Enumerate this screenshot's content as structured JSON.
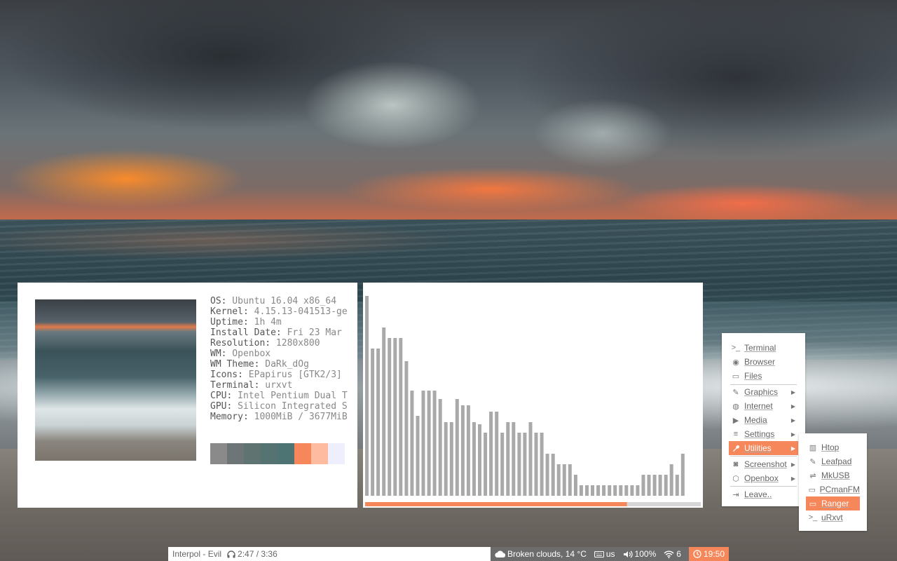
{
  "sysinfo": {
    "lines": [
      {
        "key": "OS:",
        "value": " Ubuntu 16.04 x86_64"
      },
      {
        "key": "Kernel:",
        "value": " 4.15.13-041513-ge"
      },
      {
        "key": "Uptime:",
        "value": " 1h 4m"
      },
      {
        "key": "Install Date:",
        "value": " Fri 23 Mar"
      },
      {
        "key": "Resolution:",
        "value": " 1280x800"
      },
      {
        "key": "WM:",
        "value": " Openbox"
      },
      {
        "key": "WM Theme:",
        "value": " DaRk_dOg"
      },
      {
        "key": "Icons:",
        "value": " EPapirus [GTK2/3]"
      },
      {
        "key": "Terminal:",
        "value": " urxvt"
      },
      {
        "key": "CPU:",
        "value": " Intel Pentium Dual T"
      },
      {
        "key": "GPU:",
        "value": " Silicon Integrated S"
      },
      {
        "key": "Memory:",
        "value": " 1000MiB / 3677MiB"
      }
    ],
    "palette": [
      "#8a8a8a",
      "#6d7576",
      "#5f7370",
      "#557370",
      "#4d7473",
      "#f5875a",
      "#ffbba0",
      "#eeeefc"
    ]
  },
  "visualizer": {
    "levels": [
      0.95,
      0.7,
      0.7,
      0.8,
      0.75,
      0.75,
      0.75,
      0.64,
      0.5,
      0.38,
      0.5,
      0.5,
      0.5,
      0.46,
      0.35,
      0.35,
      0.46,
      0.43,
      0.43,
      0.35,
      0.34,
      0.3,
      0.4,
      0.4,
      0.3,
      0.35,
      0.35,
      0.3,
      0.3,
      0.35,
      0.3,
      0.3,
      0.2,
      0.2,
      0.15,
      0.15,
      0.15,
      0.1,
      0.05,
      0.05,
      0.05,
      0.05,
      0.05,
      0.05,
      0.05,
      0.05,
      0.05,
      0.05,
      0.05,
      0.1,
      0.1,
      0.1,
      0.1,
      0.1,
      0.15,
      0.1,
      0.2
    ],
    "progress": 0.78,
    "bar_color": "#a9a9a9",
    "progress_color": "#f5875a",
    "track_color": "#d6d6d6"
  },
  "menu": {
    "items": [
      {
        "label": "Terminal",
        "icon": "terminal-icon",
        "glyph": ">_"
      },
      {
        "label": "Browser",
        "icon": "browser-icon",
        "glyph": "◉"
      },
      {
        "label": "Files",
        "icon": "folder-icon",
        "glyph": "▭"
      },
      {
        "label": "Graphics",
        "icon": "brush-icon",
        "glyph": "✎"
      },
      {
        "label": "Internet",
        "icon": "globe-icon",
        "glyph": "◍"
      },
      {
        "label": "Media",
        "icon": "play-icon",
        "glyph": "▶"
      },
      {
        "label": "Settings",
        "icon": "sliders-icon",
        "glyph": "≡"
      },
      {
        "label": "Utilities",
        "icon": "wrench-icon",
        "glyph": "🔧"
      },
      {
        "label": "Screenshot",
        "icon": "camera-icon",
        "glyph": "◙"
      },
      {
        "label": "Openbox",
        "icon": "box-icon",
        "glyph": "⬡"
      },
      {
        "label": "Leave..",
        "icon": "logout-icon",
        "glyph": "⇥"
      }
    ],
    "submenu": [
      {
        "label": "Htop",
        "icon": "chart-icon",
        "glyph": "▥"
      },
      {
        "label": "Leafpad",
        "icon": "edit-icon",
        "glyph": "✎"
      },
      {
        "label": "MkUSB",
        "icon": "usb-icon",
        "glyph": "⇌"
      },
      {
        "label": "PCmanFM",
        "icon": "folder-open-icon",
        "glyph": "▭"
      },
      {
        "label": "Ranger",
        "icon": "folder-icon",
        "glyph": "▭"
      },
      {
        "label": "uRxvt",
        "icon": "terminal-icon",
        "glyph": ">_"
      }
    ]
  },
  "taskbar": {
    "track": "Interpol - Evil",
    "time": "2:47 / 3:36",
    "weather": "Broken clouds, 14 °C",
    "keyboard": "us",
    "volume": "100%",
    "wifi": "6",
    "clock": "19:50"
  }
}
